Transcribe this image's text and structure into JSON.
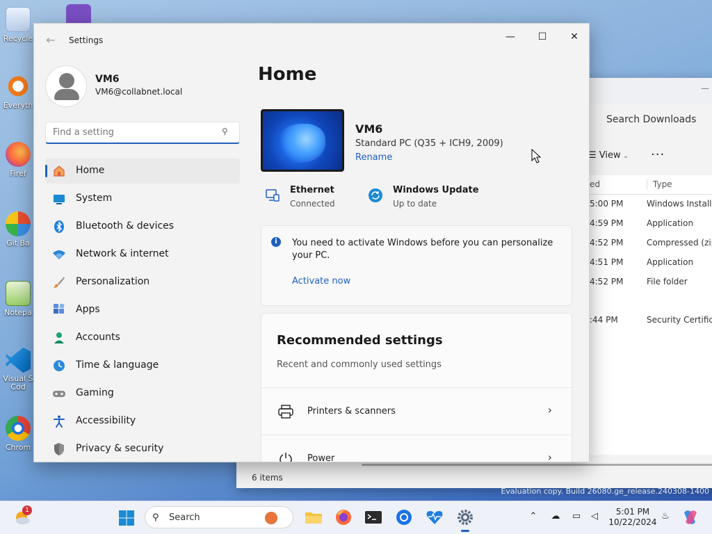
{
  "desktop": {
    "icons": [
      {
        "label": "Recycle"
      },
      {
        "label": "Everyth"
      },
      {
        "label": "Firef"
      },
      {
        "label": "Git Ba"
      },
      {
        "label": "Notepa"
      },
      {
        "label": "Visual S\nCod"
      },
      {
        "label": "Chrom"
      }
    ],
    "watermark": "Evaluation copy. Build 26080.ge_release.240308-1400"
  },
  "explorer": {
    "search_placeholder": "Search Downloads",
    "view_label": "View",
    "more_label": "···",
    "col_modified": "ed",
    "col_type": "Type",
    "rows": [
      {
        "time": "5:00 PM",
        "type": "Windows Installer"
      },
      {
        "time": "4:59 PM",
        "type": "Application"
      },
      {
        "time": "4:52 PM",
        "type": "Compressed (zipp"
      },
      {
        "time": "4:51 PM",
        "type": "Application"
      },
      {
        "time": "4:52 PM",
        "type": "File folder"
      },
      {
        "time": ":44 PM",
        "type": "Security Certificat"
      }
    ],
    "status": "6 items"
  },
  "settings": {
    "window_title": "Settings",
    "back_icon": "←",
    "minimize_icon": "—",
    "maximize_icon": "☐",
    "close_icon": "✕",
    "user": {
      "name": "VM6",
      "email": "VM6@collabnet.local"
    },
    "search_placeholder": "Find a setting",
    "nav": [
      {
        "label": "Home",
        "icon": "home-icon",
        "active": true
      },
      {
        "label": "System",
        "icon": "system-icon"
      },
      {
        "label": "Bluetooth & devices",
        "icon": "bluetooth-icon"
      },
      {
        "label": "Network & internet",
        "icon": "wifi-icon"
      },
      {
        "label": "Personalization",
        "icon": "brush-icon"
      },
      {
        "label": "Apps",
        "icon": "apps-icon"
      },
      {
        "label": "Accounts",
        "icon": "person-icon"
      },
      {
        "label": "Time & language",
        "icon": "clock-globe-icon"
      },
      {
        "label": "Gaming",
        "icon": "gamepad-icon"
      },
      {
        "label": "Accessibility",
        "icon": "accessibility-icon"
      },
      {
        "label": "Privacy & security",
        "icon": "shield-icon"
      }
    ],
    "home": {
      "title": "Home",
      "device_name": "VM6",
      "device_desc": "Standard PC (Q35 + ICH9, 2009)",
      "rename_label": "Rename",
      "ethernet": {
        "title": "Ethernet",
        "status": "Connected"
      },
      "update": {
        "title": "Windows Update",
        "status": "Up to date"
      },
      "activation_message": "You need to activate Windows before you can personalize your PC.",
      "activate_link": "Activate now",
      "recommended_title": "Recommended settings",
      "recommended_subtitle": "Recent and commonly used settings",
      "recommended_items": [
        {
          "label": "Printers & scanners",
          "icon": "printer-icon"
        },
        {
          "label": "Power",
          "icon": "power-icon"
        }
      ]
    }
  },
  "taskbar": {
    "search_label": "Search",
    "notification_count": "1",
    "time": "5:01 PM",
    "date": "10/22/2024",
    "accent": "#1f5fbf"
  }
}
